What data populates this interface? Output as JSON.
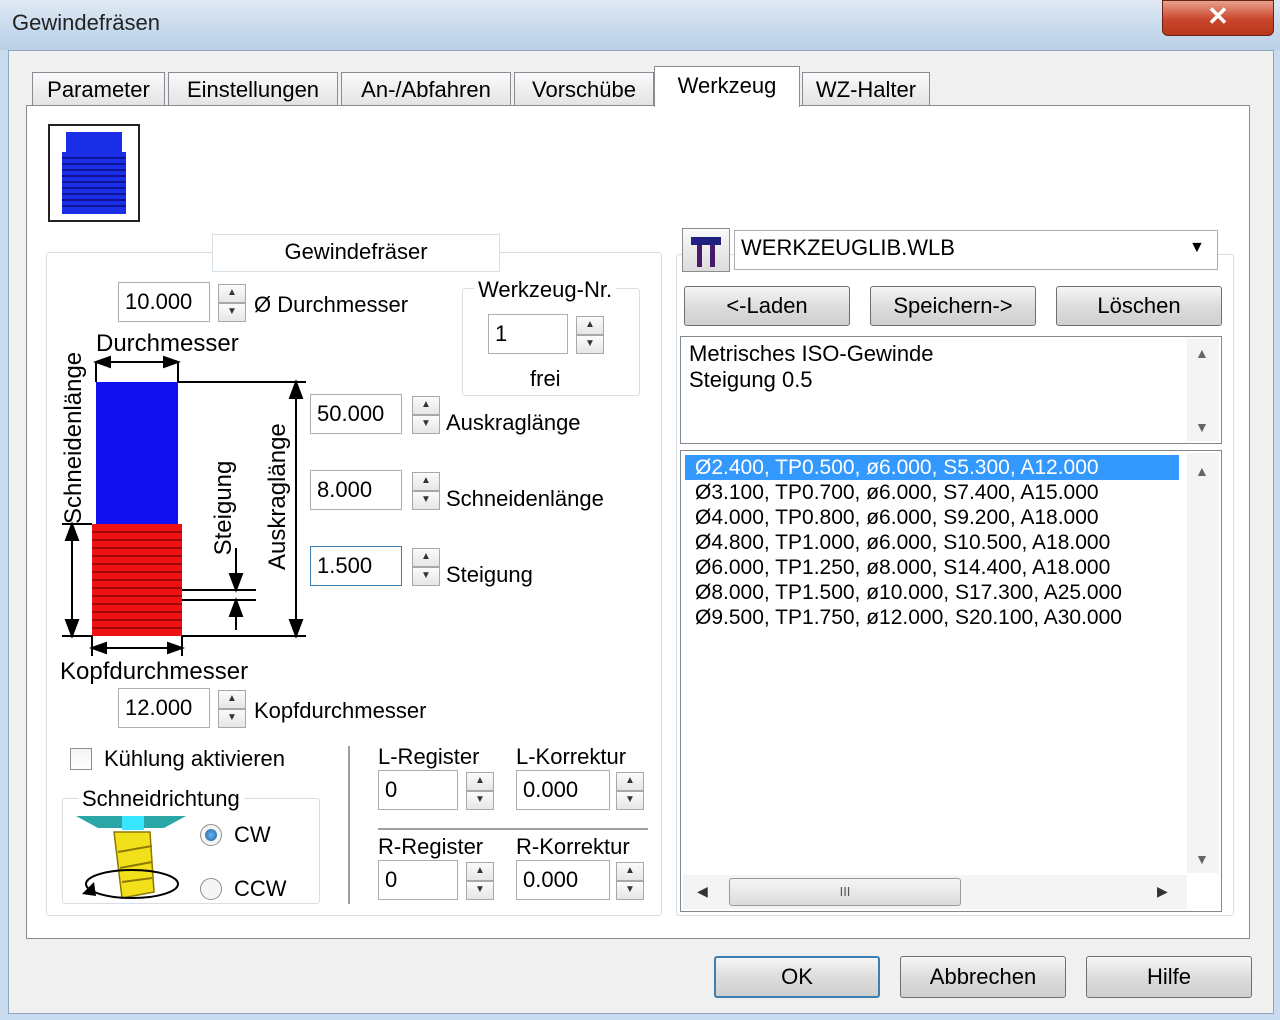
{
  "window": {
    "title": "Gewindefräsen",
    "close_glyph": "✕"
  },
  "tabs": [
    {
      "label": "Parameter",
      "active": false
    },
    {
      "label": "Einstellungen",
      "active": false
    },
    {
      "label": "An-/Abfahren",
      "active": false
    },
    {
      "label": "Vorschübe",
      "active": false
    },
    {
      "label": "Werkzeug",
      "active": true
    },
    {
      "label": "WZ-Halter",
      "active": false
    }
  ],
  "tool": {
    "group_title": "Gewindefräser",
    "diameter": {
      "value": "10.000",
      "label": "Ø Durchmesser"
    },
    "tool_number": {
      "group_title": "Werkzeug-Nr.",
      "value": "1",
      "status": "frei"
    },
    "overhang": {
      "value": "50.000",
      "label": "Auskraglänge"
    },
    "cutting_length": {
      "value": "8.000",
      "label": "Schneidenlänge"
    },
    "pitch": {
      "value": "1.500",
      "label": "Steigung"
    },
    "head_diameter": {
      "value": "12.000",
      "label": "Kopfdurchmesser"
    },
    "diagram": {
      "durchmesser": "Durchmesser",
      "schneidenlaenge": "Schneidenlänge",
      "steigung": "Steigung",
      "auskraglaenge": "Auskraglänge",
      "kopfdurchmesser": "Kopfdurchmesser"
    },
    "coolant": {
      "label": "Kühlung aktivieren",
      "checked": false
    },
    "cut_direction": {
      "title": "Schneidrichtung",
      "options": [
        {
          "label": "CW",
          "selected": true
        },
        {
          "label": "CCW",
          "selected": false
        }
      ]
    },
    "l_register": {
      "label": "L-Register",
      "value": "0"
    },
    "l_correction": {
      "label": "L-Korrektur",
      "value": "0.000"
    },
    "r_register": {
      "label": "R-Register",
      "value": "0"
    },
    "r_correction": {
      "label": "R-Korrektur",
      "value": "0.000"
    }
  },
  "library": {
    "file": "WERKZEUGLIB.WLB",
    "load_label": "<-Laden",
    "save_label": "Speichern->",
    "delete_label": "Löschen",
    "description": [
      "Metrisches ISO-Gewinde",
      "Steigung 0.5"
    ],
    "entries": [
      "Ø2.400, TP0.500, ø6.000, S5.300, A12.000",
      "Ø3.100, TP0.700, ø6.000, S7.400, A15.000",
      "Ø4.000, TP0.800, ø6.000, S9.200, A18.000",
      "Ø4.800, TP1.000, ø6.000, S10.500, A18.000",
      "Ø6.000, TP1.250, ø8.000, S14.400, A18.000",
      "Ø8.000, TP1.500, ø10.000, S17.300, A25.000",
      "Ø9.500, TP1.750, ø12.000, S20.100, A30.000"
    ],
    "selected_index": 0,
    "hscroll_grip": "III"
  },
  "footer": {
    "ok": "OK",
    "cancel": "Abbrechen",
    "help": "Hilfe"
  },
  "colors": {
    "shank": "#1010f0",
    "cutting": "#ee1111",
    "selection": "#3399ff"
  }
}
